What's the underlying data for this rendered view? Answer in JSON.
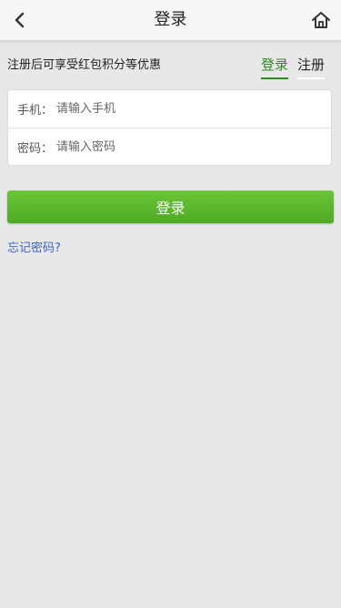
{
  "header": {
    "title": "登录",
    "back_icon": "chevron-left-icon",
    "home_icon": "home-icon"
  },
  "promo": {
    "text": "注册后可享受红包积分等优惠"
  },
  "tabs": [
    {
      "label": "登录",
      "active": true
    },
    {
      "label": "注册",
      "active": false
    }
  ],
  "form": {
    "phone_label": "手机：",
    "phone_placeholder": "请输入手机",
    "phone_value": "",
    "password_label": "密码：",
    "password_placeholder": "请输入密码",
    "password_value": ""
  },
  "actions": {
    "login_label": "登录",
    "forgot_label": "忘记密码?"
  },
  "colors": {
    "accent_green": "#2f8a1f",
    "button_green": "#5cb82e",
    "link_blue": "#3a66c4",
    "background": "#e8e8e8"
  }
}
